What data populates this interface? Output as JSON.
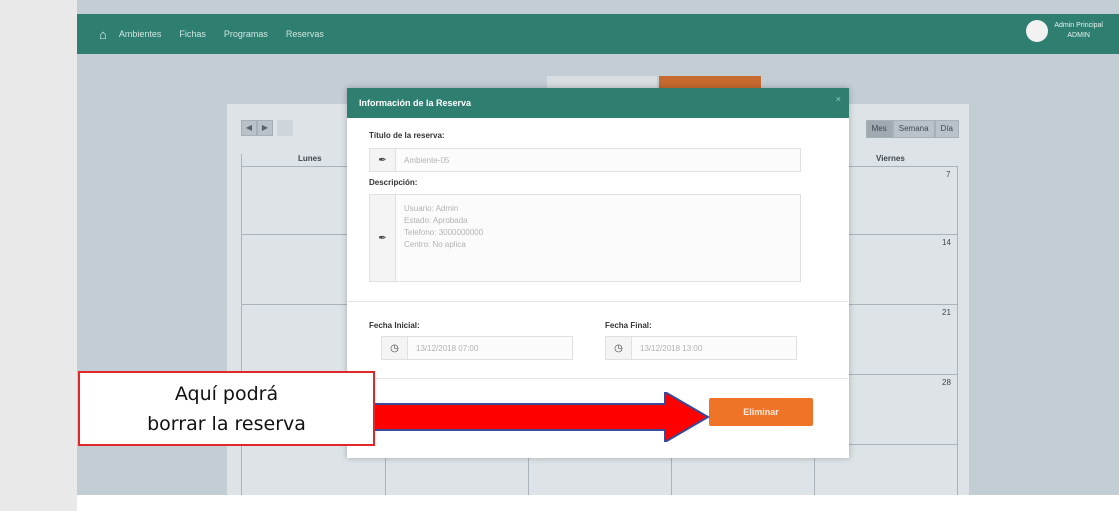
{
  "navbar": {
    "home_icon": "home-icon",
    "links": [
      "Ambientes",
      "Fichas",
      "Programas",
      "Reservas"
    ],
    "user_name": "Admin Principal",
    "user_role": "ADMIN"
  },
  "calendar": {
    "prev_icon": "chevron-left-icon",
    "next_icon": "chevron-right-icon",
    "views": [
      "Mes",
      "Semana",
      "Día"
    ],
    "active_view": "Mes",
    "col_headers": [
      "Lunes",
      "Viernes"
    ],
    "day_numbers": [
      "7",
      "14",
      "21",
      "28"
    ]
  },
  "modal": {
    "title": "Información de la Reserva",
    "close_symbol": "×",
    "title_label": "Título de la reserva:",
    "title_value": "Ambiente-05",
    "description_label": "Descripción:",
    "description_lines": [
      "Usuario: Admin",
      "Estado: Aprobada",
      "Telefono: 3000000000",
      "Centro: No aplica"
    ],
    "start_label": "Fecha Inicial:",
    "start_value": "13/12/2018 07:00",
    "end_label": "Fecha Final:",
    "end_value": "13/12/2018 13:00",
    "delete_label": "Eliminar"
  },
  "annotation": {
    "line1": "Aquí podrá",
    "line2": "borrar la reserva",
    "box_color": "#e0282a",
    "arrow_color": "#ff0000",
    "arrow_outline": "#3a4a9a"
  },
  "colors": {
    "navbar": "#2f7f70",
    "accent": "#ef7427"
  }
}
